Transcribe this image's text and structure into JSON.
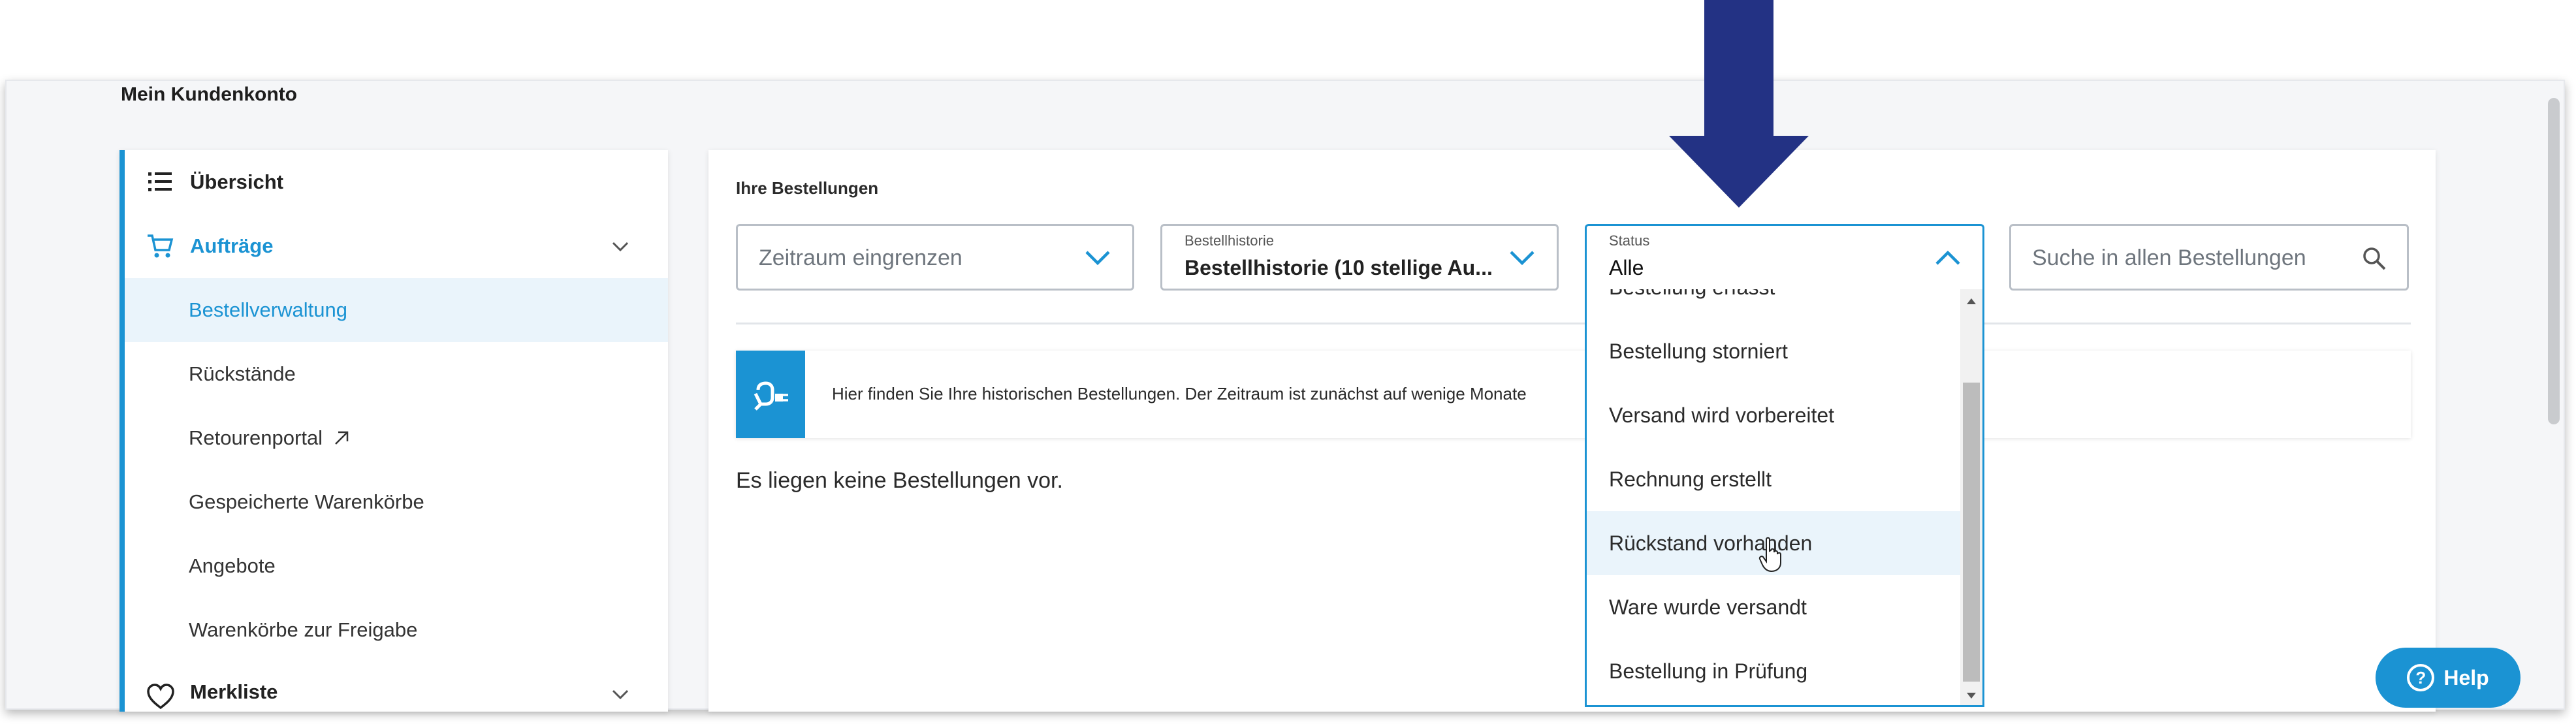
{
  "page_title": "Mein Kundenkonto",
  "colors": {
    "accent": "#1b93d3",
    "arrow": "#233284"
  },
  "sidebar": {
    "items": [
      {
        "label": "Übersicht",
        "icon": "list-icon"
      },
      {
        "label": "Aufträge",
        "icon": "cart-icon"
      },
      {
        "label": "Bestellverwaltung"
      },
      {
        "label": "Rückstände"
      },
      {
        "label": "Retourenportal",
        "icon": "external-link-icon"
      },
      {
        "label": "Gespeicherte Warenkörbe"
      },
      {
        "label": "Angebote"
      },
      {
        "label": "Warenkörbe zur Freigabe"
      },
      {
        "label": "Merkliste",
        "icon": "heart-icon"
      }
    ]
  },
  "orders": {
    "title": "Ihre Bestellungen",
    "period_placeholder": "Zeitraum eingrenzen",
    "history_label": "Bestellhistorie",
    "history_value": "Bestellhistorie (10 stellige Au...",
    "status_label": "Status",
    "status_value": "Alle",
    "search_placeholder": "Suche in allen Bestellungen",
    "info_text": "Hier finden Sie Ihre historischen Bestellungen. Der Zeitraum ist zunächst auf wenige Monate",
    "empty_text": "Es liegen keine Bestellungen vor."
  },
  "status_options": [
    "Bestellung erfasst",
    "Bestellung storniert",
    "Versand wird vorbereitet",
    "Rechnung erstellt",
    "Rückstand vorhanden",
    "Ware wurde versandt",
    "Bestellung in Prüfung"
  ],
  "help_label": "Help"
}
